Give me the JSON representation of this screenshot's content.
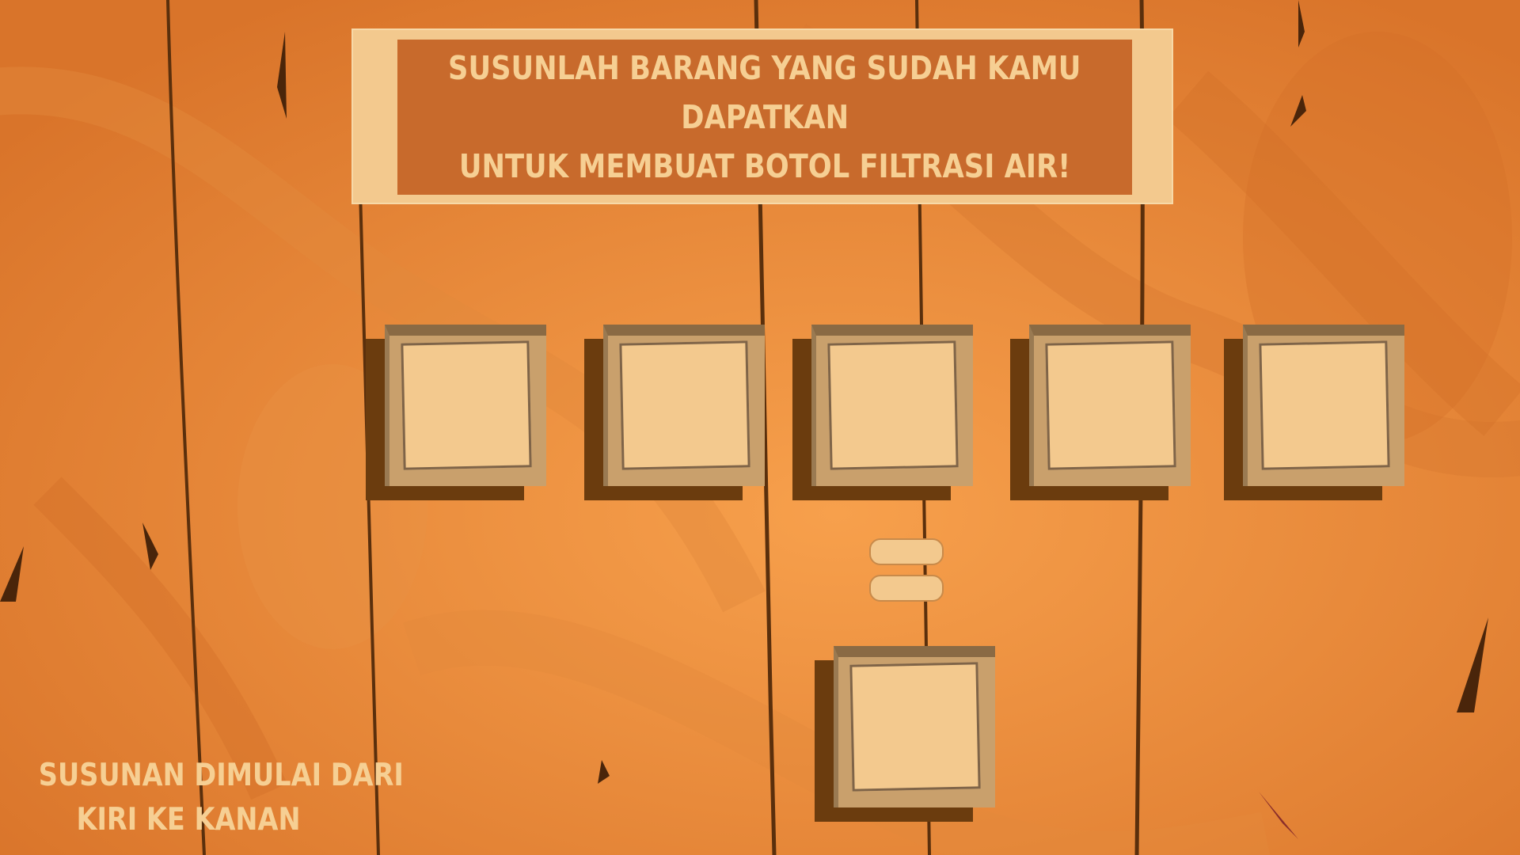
{
  "banner": {
    "lines": [
      "SUSUNLAH BARANG YANG SUDAH KAMU",
      "DAPATKAN",
      "UNTUK MEMBUAT BOTOL FILTRASI AIR!"
    ]
  },
  "input_slots": [
    "",
    "",
    "",
    "",
    ""
  ],
  "result_slot": "",
  "equals_symbol": "=",
  "hint": {
    "lines": [
      "SUSUNAN DIMULAI DARI",
      "KIRI KE KANAN"
    ]
  },
  "colors": {
    "background": "#e8852e",
    "banner_outer": "#f3c98e",
    "banner_inner": "#c86a2c",
    "text": "#f6cf93",
    "slot_paper": "#f3c98e",
    "slot_shadow": "#6b3c0e"
  }
}
